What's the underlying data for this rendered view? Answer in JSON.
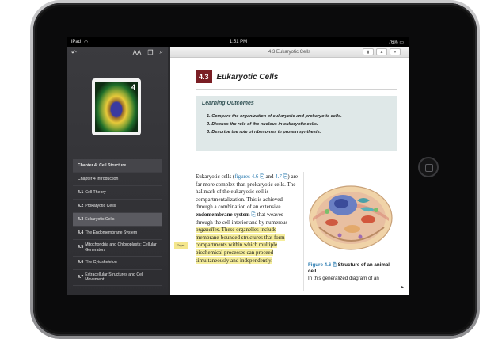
{
  "status": {
    "device": "iPad",
    "time": "1:51 PM",
    "battery": "76%"
  },
  "sidebar": {
    "cover_number": "4",
    "text_size_label": "AA",
    "highlight_tag": "Organ.",
    "toc": [
      {
        "number": "",
        "label": "Chapter 4: Cell Structure"
      },
      {
        "number": "",
        "label": "Chapter 4 Introduction"
      },
      {
        "number": "4.1",
        "label": "Cell Theory"
      },
      {
        "number": "4.2",
        "label": "Prokaryotic Cells"
      },
      {
        "number": "4.3",
        "label": "Eukaryotic Cells"
      },
      {
        "number": "4.4",
        "label": "The Endomembrane System"
      },
      {
        "number": "4.5",
        "label": "Mitochondria and Chloroplasts: Cellular Generators"
      },
      {
        "number": "4.6",
        "label": "The Cytoskeleton"
      },
      {
        "number": "4.7",
        "label": "Extracellular Structures and Cell Movement"
      }
    ]
  },
  "reader": {
    "toolbar_title": "4.3 Eukaryotic Cells",
    "section_number": "4.3",
    "section_title": "Eukaryotic Cells",
    "outcomes_title": "Learning Outcomes",
    "outcomes": [
      "1.   Compare the organization of eukaryotic and prokaryotic cells.",
      "2.   Discuss the role of the nucleus in eukaryotic cells.",
      "3.   Describe the role of ribosomes in protein synthesis."
    ],
    "body": {
      "p1": "Eukaryotic cells (",
      "link1": "figures 4.6",
      "p2": " and ",
      "link2": "4.7",
      "p3": ") are far more complex than prokaryotic cells. The hallmark of the eukaryotic cell is compartmentalization. This is achieved through a combination of an extensive ",
      "bold1": "endomembrane system",
      "p4": " that weaves through the cell interior and by numerous ",
      "highlight_italic": "organelles",
      "highlight_rest": ". These organelles include membrane-bounded structures that form compartments within which multiple biochemical processes can proceed simultaneously and independently."
    },
    "figure": {
      "label": "Figure 4.6",
      "title": "Structure of an animal cell.",
      "caption": "In this generalized diagram of an"
    }
  }
}
